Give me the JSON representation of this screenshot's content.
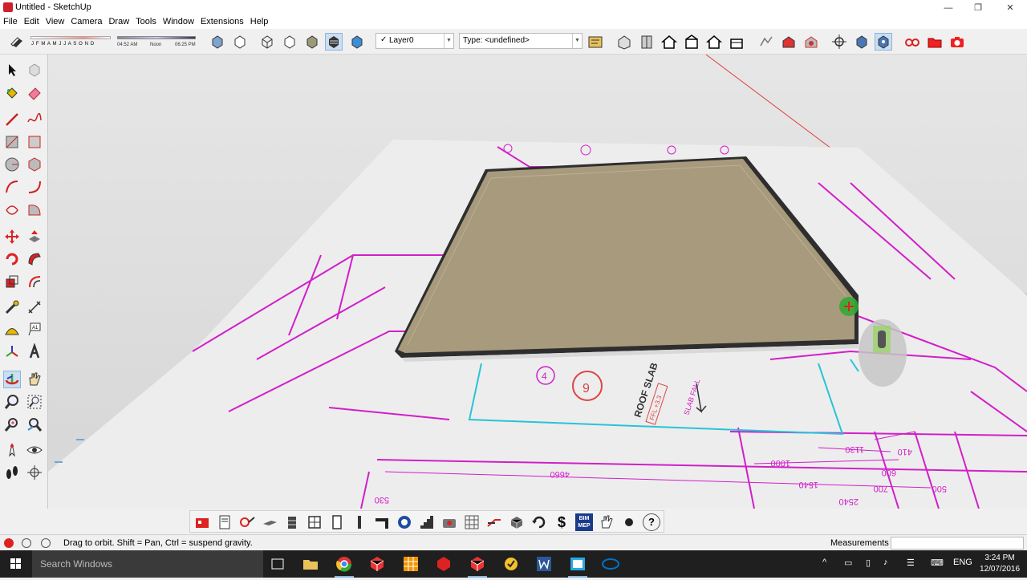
{
  "window": {
    "title": "Untitled - SketchUp",
    "minimize": "—",
    "restore": "❐",
    "close": "✕"
  },
  "menu": [
    "File",
    "Edit",
    "View",
    "Camera",
    "Draw",
    "Tools",
    "Window",
    "Extensions",
    "Help"
  ],
  "shadow": {
    "months": "J F M A M J J A S O N D",
    "time_start": "04:52 AM",
    "time_mid": "Noon",
    "time_end": "06:25 PM"
  },
  "layer": {
    "check": "✓",
    "value": "Layer0",
    "arrow": "▼"
  },
  "type_field": {
    "value": "Type: <undefined>",
    "arrow": "▼"
  },
  "drawing": {
    "dim_4660": "4660",
    "dim_1000": "1000",
    "dim_1540": "1540",
    "dim_1130": "1130",
    "dim_600": "600",
    "dim_700": "700",
    "dim_410": "410",
    "dim_530": "530",
    "dim_2540": "2540",
    "dim_500": "500",
    "roof_slab": "ROOF SLAB",
    "ffl": "FFL +3.3",
    "slab_fall": "SLAB FALL",
    "grid_4": "4",
    "grid_9": "9"
  },
  "status": {
    "hint": "Drag to orbit. Shift = Pan, Ctrl = suspend gravity.",
    "measurements_label": "Measurements",
    "measurements_value": ""
  },
  "taskbar": {
    "search_placeholder": "Search Windows",
    "language": "ENG",
    "time": "3:24 PM",
    "date": "12/07/2016"
  },
  "bottom_tools": {
    "dollar": "$",
    "bim": "BIM",
    "mep": "MEP",
    "help": "?"
  },
  "colors": {
    "accent": "#c9dff4",
    "plan_magenta": "#d11fc9",
    "plan_cyan": "#27c4d6",
    "slab_top": "#a89a7c",
    "sketchup_red": "#d0212a"
  }
}
